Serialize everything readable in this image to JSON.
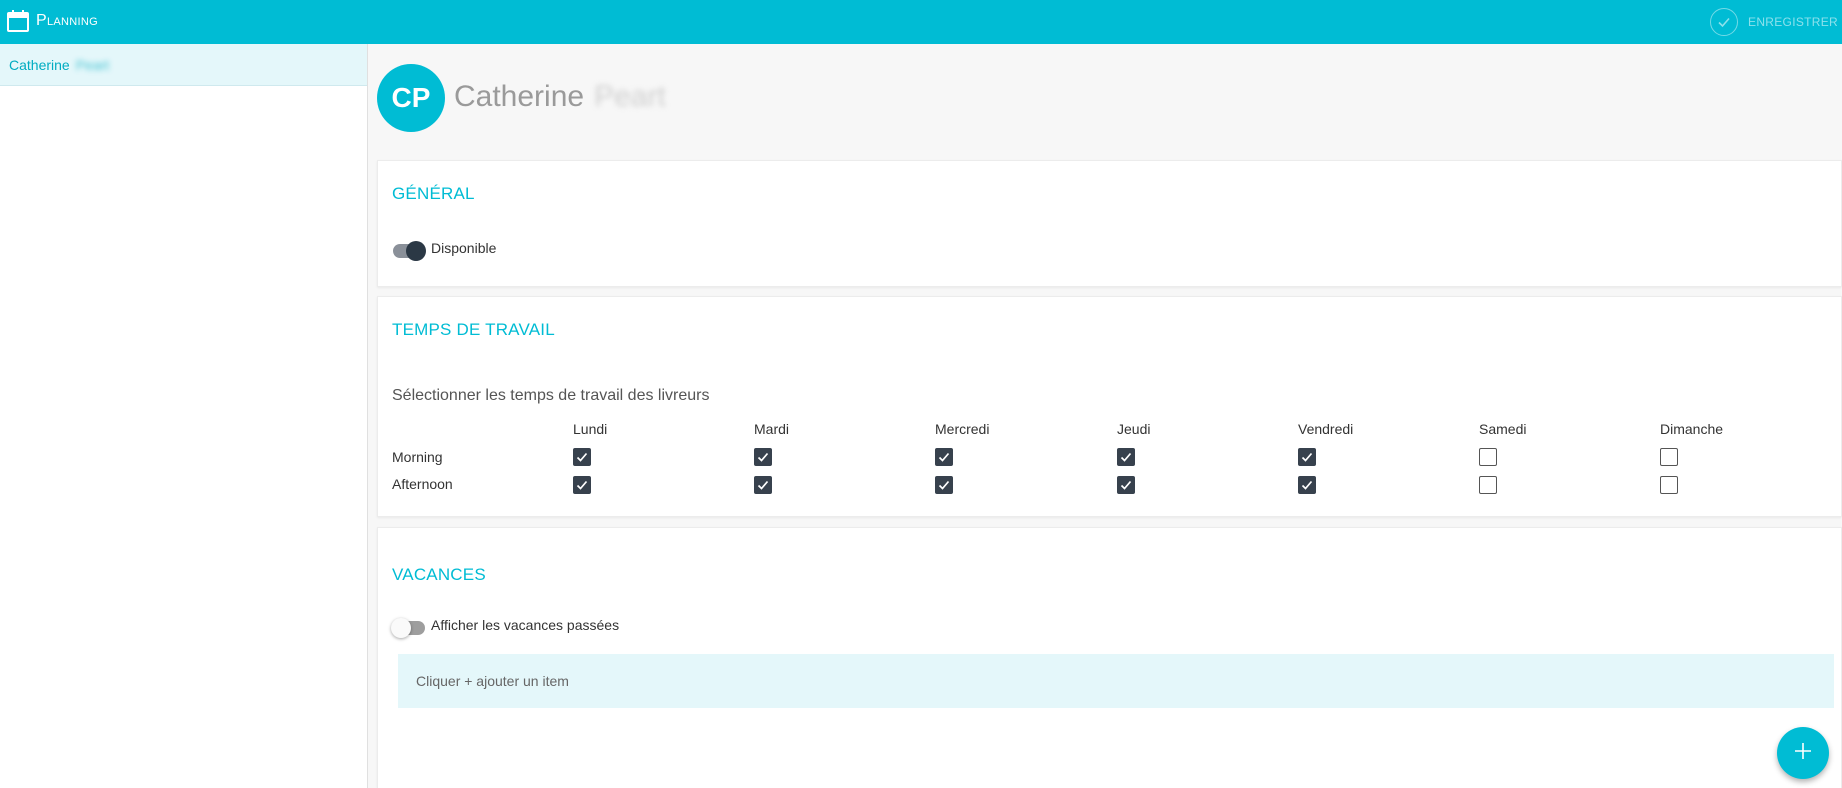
{
  "app": {
    "title": "Planning",
    "icon": "calendar-icon"
  },
  "toolbar": {
    "save_label": "ENREGISTRER",
    "save_icon": "check-circle-icon"
  },
  "sidebar": {
    "items": [
      {
        "first_name": "Catherine",
        "last_name": "Peart",
        "selected": true
      }
    ]
  },
  "person": {
    "initials": "CP",
    "first_name": "Catherine",
    "last_name": "Peart"
  },
  "general": {
    "title": "GÉNÉRAL",
    "available_label": "Disponible",
    "available": true
  },
  "worktime": {
    "title": "TEMPS DE TRAVAIL",
    "subtitle": "Sélectionner les temps de travail des livreurs",
    "days": [
      "Lundi",
      "Mardi",
      "Mercredi",
      "Jeudi",
      "Vendredi",
      "Samedi",
      "Dimanche"
    ],
    "rows": [
      {
        "label": "Morning",
        "values": [
          true,
          true,
          true,
          true,
          true,
          false,
          false
        ]
      },
      {
        "label": "Afternoon",
        "values": [
          true,
          true,
          true,
          true,
          true,
          false,
          false
        ]
      }
    ]
  },
  "holidays": {
    "title": "VACANCES",
    "show_past_label": "Afficher les vacances passées",
    "show_past": false,
    "empty_text": "Cliquer + ajouter un item"
  },
  "fab": {
    "icon": "plus-icon"
  },
  "colors": {
    "accent": "#00bcd4",
    "checkbox": "#37414d",
    "highlight": "#e4f7fa"
  }
}
